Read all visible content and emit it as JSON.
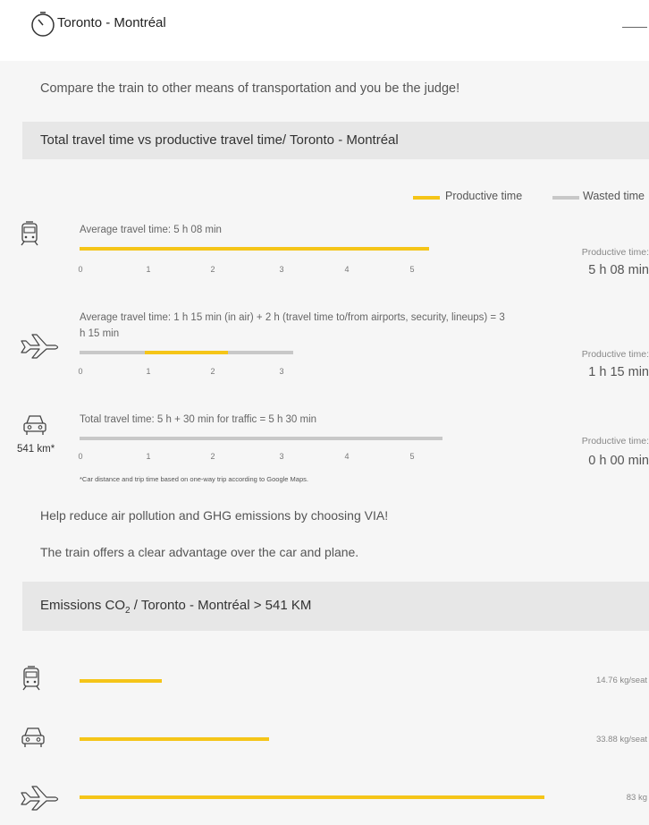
{
  "header": {
    "title": "Toronto - Montréal",
    "icon": "clock-icon",
    "collapse_icon": "minus-icon"
  },
  "intro": "Compare the train to other means of transportation and you be the judge!",
  "section1": {
    "title": "Total travel time vs productive travel time/ Toronto - Montréal"
  },
  "legend": {
    "productive": {
      "label": "Productive time",
      "color": "#f5c518"
    },
    "wasted": {
      "label": "Wasted time",
      "color": "#c8c8c8"
    }
  },
  "modes": {
    "train": {
      "icon": "train-icon",
      "caption": "Average travel time: 5 h 08 min",
      "ticks": [
        "0",
        "1",
        "2",
        "3",
        "4",
        "5"
      ],
      "productive_label": "Productive time:",
      "productive_value": "5 h 08 min"
    },
    "plane": {
      "icon": "plane-icon",
      "caption_line1": "Average travel time: 1 h 15 min (in air) + 2 h (travel time to/from airports, security, lineups) = 3",
      "caption_line2": "h 15 min",
      "ticks": [
        "0",
        "1",
        "2",
        "3"
      ],
      "productive_label": "Productive time:",
      "productive_value": "1 h 15 min"
    },
    "car": {
      "icon": "car-icon",
      "distance": "541 km*",
      "caption": "Total travel time: 5 h + 30 min for traffic = 5 h 30 min",
      "ticks": [
        "0",
        "1",
        "2",
        "3",
        "4",
        "5"
      ],
      "productive_label": "Productive time:",
      "productive_value": "0 h 00 min",
      "footnote": "*Car distance and trip time based on one-way trip according to Google Maps."
    }
  },
  "text": {
    "p1": "Help reduce air pollution and GHG emissions by choosing VIA!",
    "p2": "The train offers a clear advantage over the car and plane."
  },
  "section2": {
    "title_prefix": "Emissions CO",
    "title_sub": "2",
    "title_suffix": " / Toronto - Montréal > 541 KM"
  },
  "emissions": [
    {
      "icon": "train-icon",
      "value": "14.76 kg/seat",
      "amount": 14.76
    },
    {
      "icon": "car-icon",
      "value": "33.88 kg/seat",
      "amount": 33.88
    },
    {
      "icon": "plane-icon",
      "value": "83 kg",
      "amount": 83
    }
  ]
}
